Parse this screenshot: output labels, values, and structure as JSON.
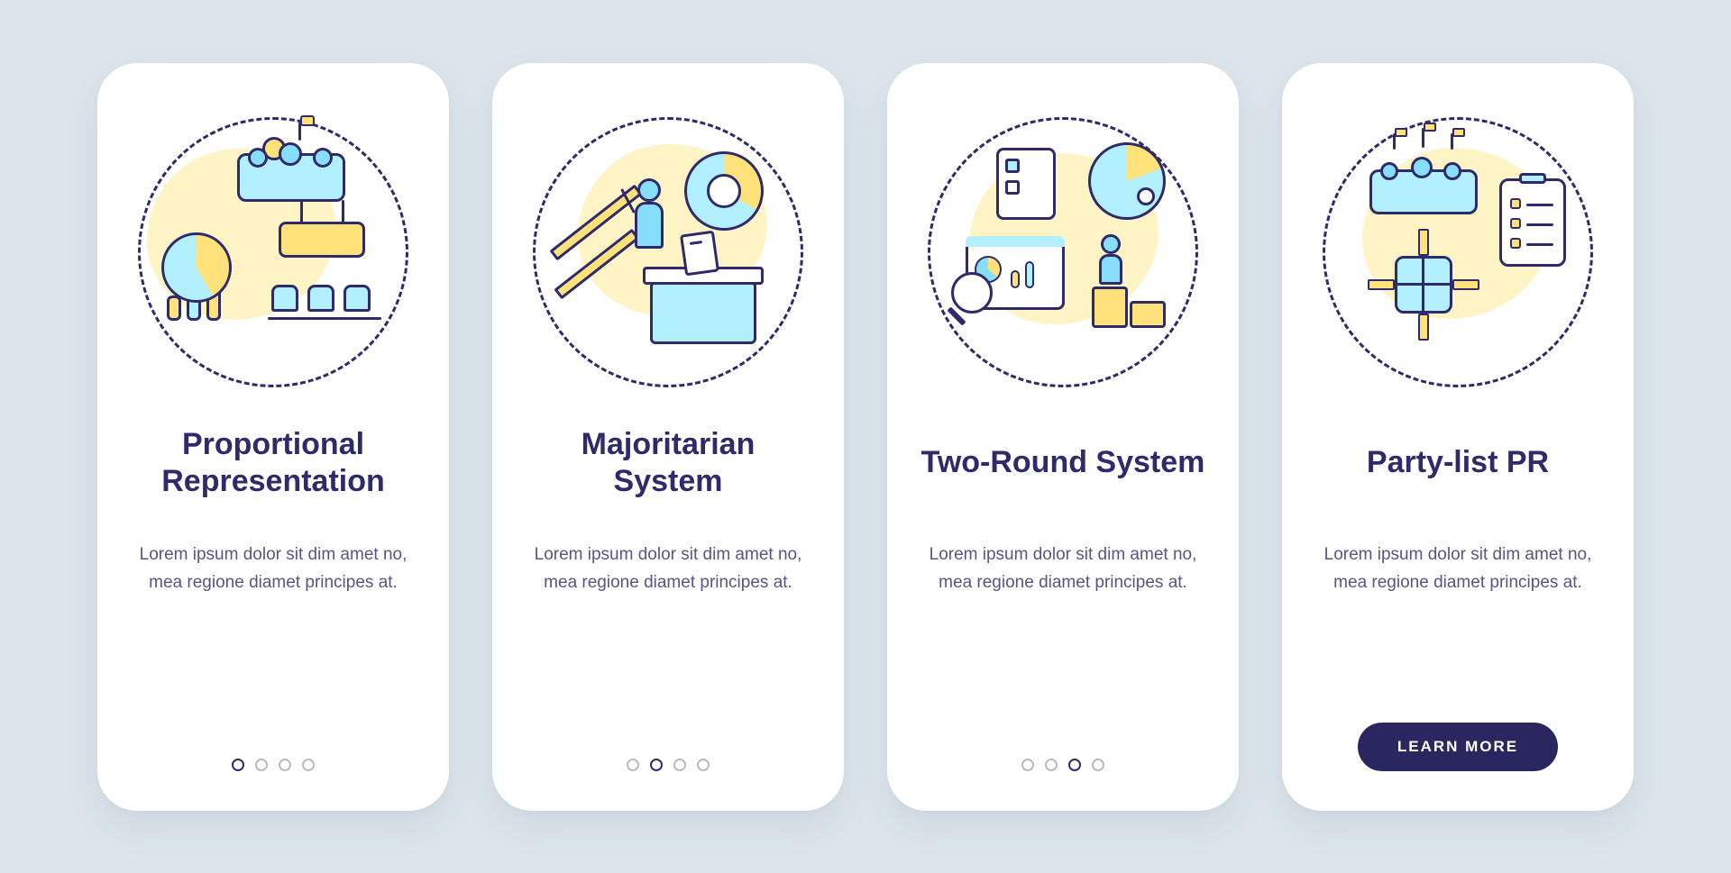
{
  "cards": [
    {
      "title": "Proportional Representation",
      "body": "Lorem ipsum dolor sit dim amet no, mea regione diamet principes at.",
      "icon_name": "proportional-representation-icon",
      "activeDot": 0,
      "dotCount": 4
    },
    {
      "title": "Majoritarian System",
      "body": "Lorem ipsum dolor sit dim amet no, mea regione diamet principes at.",
      "icon_name": "majoritarian-system-icon",
      "activeDot": 1,
      "dotCount": 4
    },
    {
      "title": "Two-Round System",
      "body": "Lorem ipsum dolor sit dim amet no, mea regione diamet principes at.",
      "icon_name": "two-round-system-icon",
      "activeDot": 2,
      "dotCount": 4
    },
    {
      "title": "Party-list PR",
      "body": "Lorem ipsum dolor sit dim amet no, mea regione diamet principes at.",
      "icon_name": "party-list-pr-icon",
      "activeDot": null,
      "dotCount": 0,
      "cta": "LEARN MORE"
    }
  ],
  "colors": {
    "background": "#dbe5eb",
    "navy": "#2f2b6b",
    "sky": "#86defb",
    "yellow": "#ffe27a"
  }
}
